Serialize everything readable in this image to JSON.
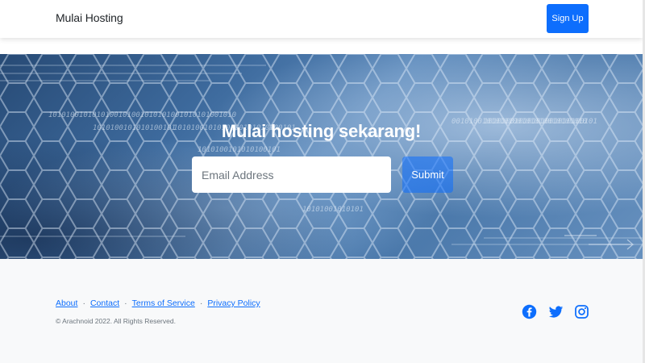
{
  "navbar": {
    "brand": "Mulai Hosting",
    "signup_label": "Sign Up"
  },
  "hero": {
    "title": "Mulai hosting sekarang!",
    "email_placeholder": "Email Address",
    "submit_label": "Submit",
    "binary_strings": [
      "1010100101010100101001010101001010101001010",
      "1010100101010100101",
      "0010100101010100101010010101010",
      "1010100101010100101",
      "10101001010101",
      "1010100101010100101010100101",
      "10101001010101001010100101"
    ]
  },
  "footer": {
    "links": [
      {
        "label": "About"
      },
      {
        "label": "Contact"
      },
      {
        "label": "Terms of Service"
      },
      {
        "label": "Privacy Policy"
      }
    ],
    "separator": "·",
    "copyright": "© Arachnoid 2022. All Rights Reserved.",
    "social_icons": [
      "facebook-icon",
      "twitter-icon",
      "instagram-icon"
    ]
  },
  "colors": {
    "primary": "#0d6efd",
    "footer_bg": "#f8f9fa",
    "hero_dark": "#274a75",
    "hero_light": "#6791bf"
  }
}
